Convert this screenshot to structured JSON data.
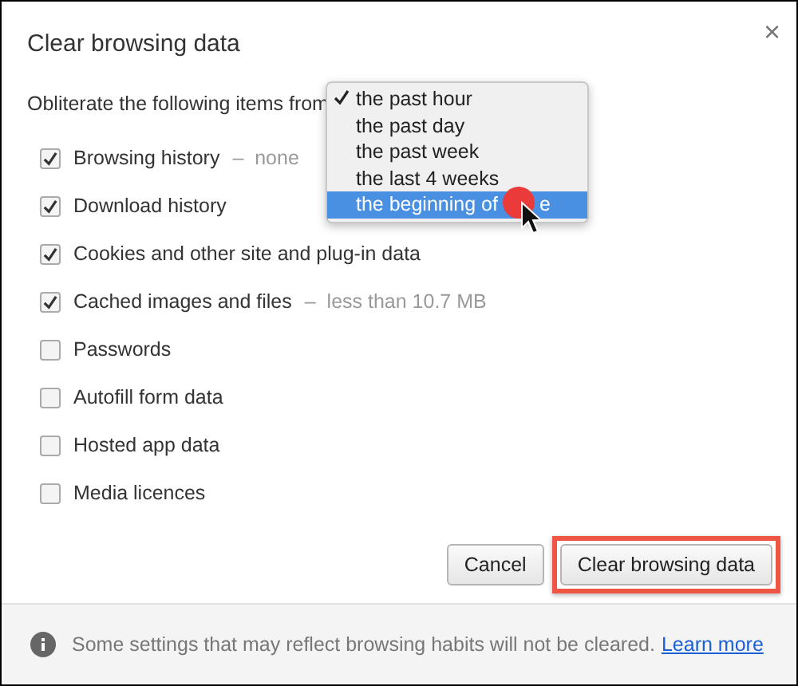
{
  "dialog": {
    "title": "Clear browsing data",
    "close": "×"
  },
  "prompt": "Obliterate the following items from",
  "dropdown": {
    "options": [
      {
        "label": "the past hour",
        "selected": true,
        "highlighted": false
      },
      {
        "label": "the past day",
        "selected": false,
        "highlighted": false
      },
      {
        "label": "the past week",
        "selected": false,
        "highlighted": false
      },
      {
        "label": "the last 4 weeks",
        "selected": false,
        "highlighted": false
      },
      {
        "label": "the beginning of",
        "tail": "e",
        "selected": false,
        "highlighted": true
      }
    ]
  },
  "items": [
    {
      "label": "Browsing history",
      "note": "–  none",
      "checked": true
    },
    {
      "label": "Download history",
      "checked": true
    },
    {
      "label": "Cookies and other site and plug-in data",
      "checked": true
    },
    {
      "label": "Cached images and files",
      "note": "–  less than 10.7 MB",
      "checked": true
    },
    {
      "label": "Passwords",
      "checked": false
    },
    {
      "label": "Autofill form data",
      "checked": false
    },
    {
      "label": "Hosted app data",
      "checked": false
    },
    {
      "label": "Media licences",
      "checked": false
    }
  ],
  "buttons": [
    {
      "label": "Cancel",
      "highlighted": false
    },
    {
      "label": "Clear browsing data",
      "highlighted": true
    }
  ],
  "footer": {
    "text": "Some settings that may reflect browsing habits will not be cleared.",
    "link": "Learn more"
  }
}
